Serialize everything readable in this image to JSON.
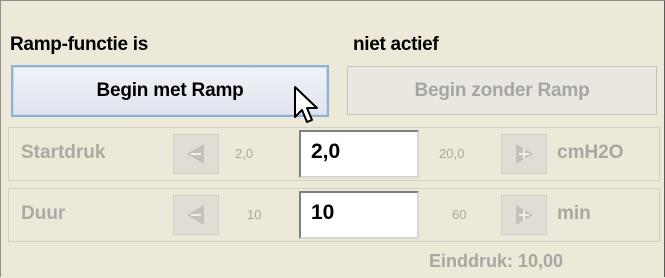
{
  "status": {
    "label": "Ramp-functie is",
    "value": "niet actief"
  },
  "buttons": {
    "begin_with_ramp": "Begin met Ramp",
    "begin_without_ramp": "Begin zonder Ramp"
  },
  "rows": [
    {
      "label": "Startdruk",
      "min": "2,0",
      "value": "2,0",
      "max": "20,0",
      "unit": "cmH2O"
    },
    {
      "label": "Duur",
      "min": "10",
      "value": "10",
      "max": "60",
      "unit": "min"
    }
  ],
  "footer": {
    "end_pressure": "Einddruk: 10,00"
  },
  "icons": {
    "decrease": "arrow-left-icon",
    "increase": "arrow-right-icon",
    "cursor": "mouse-pointer-icon"
  },
  "colors": {
    "background": "#ece9d8",
    "primary_border": "#8fb1d6",
    "disabled_text": "#a9a7a1"
  }
}
